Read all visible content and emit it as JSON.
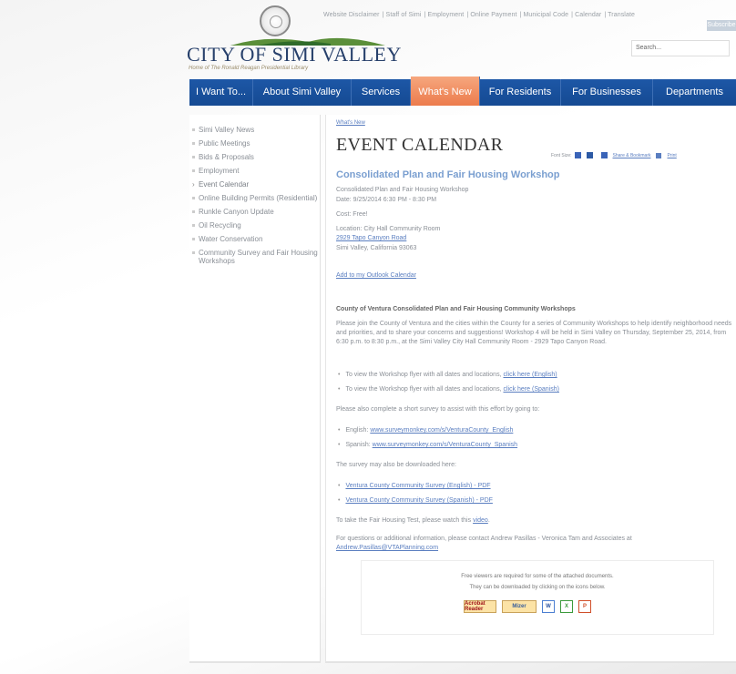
{
  "header": {
    "logo_text": "CITY OF SIMI VALLEY",
    "tagline": "Home of The Ronald Reagan Presidential Library",
    "utility_links": [
      "Website Disclaimer",
      "Staff of Simi",
      "Employment",
      "Online Payment",
      "Municipal Code",
      "Calendar",
      "Translate"
    ],
    "utility_button": "Subscribe",
    "search_placeholder": "Search..."
  },
  "nav": {
    "items": [
      {
        "label": "I Want To..."
      },
      {
        "label": "About Simi Valley"
      },
      {
        "label": "Services"
      },
      {
        "label": "What's New",
        "active": true
      },
      {
        "label": "For Residents"
      },
      {
        "label": "For Businesses"
      },
      {
        "label": "Departments"
      }
    ]
  },
  "sidebar": {
    "items": [
      "Simi Valley News",
      "Public Meetings",
      "Bids & Proposals",
      "Employment",
      "Event Calendar",
      "Online Building Permits (Residential)",
      "Runkle Canyon Update",
      "Oil Recycling",
      "Water Conservation",
      "Community Survey and Fair Housing Workshops"
    ]
  },
  "main": {
    "breadcrumb": "What's New",
    "page_title": "EVENT CALENDAR",
    "tools": {
      "font_size": "Font Size:",
      "share": "Share & Bookmark",
      "print": "Print"
    },
    "event": {
      "title": "Consolidated Plan and Fair Housing Workshop",
      "subtitle": "Consolidated Plan and Fair Housing Workshop",
      "date": "Date: 9/25/2014 6:30 PM - 8:30 PM",
      "cost": "Cost: Free!",
      "location_label": "Location: City Hall Community Room",
      "address_line1": "2929 Tapo Canyon Road",
      "address_line2": "Simi Valley, California 93063",
      "outlook_link": "Add to my Outlook Calendar"
    },
    "body": {
      "heading": "County of Ventura Consolidated Plan and Fair Housing Community Workshops",
      "intro": "Please join the County of Ventura and the cities within the County for a series of Community Workshops to help identify neighborhood needs and priorities, and to share your concerns and suggestions!  Workshop 4 will be held in Simi Valley on Thursday, September 25, 2014, from 6:30 p.m. to 8:30 p.m., at the Simi Valley City Hall Community Room - 2929 Tapo Canyon Road.",
      "flyer_text": "To view the Workshop flyer with all dates and locations,",
      "flyer_link_en": "click here (English)",
      "flyer_link_es": "click here (Spanish)",
      "survey_intro": "Please also complete a short survey to assist with this effort by going to:",
      "english_label": "English:",
      "english_link": "www.surveymonkey.com/s/VenturaCounty_English",
      "spanish_label": "Spanish:",
      "spanish_link": "www.surveymonkey.com/s/VenturaCounty_Spanish",
      "download_intro": "The survey may also be downloaded here:",
      "pdf_en": "Ventura County Community Survey (English) - PDF",
      "pdf_es": "Ventura County Community Survey (Spanish) - PDF",
      "fair_housing_text": "To take the Fair Housing Test, please watch this",
      "video_link": "video",
      "contact_text": "For questions or additional information, please contact Andrew Pasillas - Veronica Tam and Associates at",
      "contact_email": "Andrew.Pasillas@VTAPlanning.com"
    },
    "viewers": {
      "line1": "Free viewers are required for some of the attached documents.",
      "line2": "They can be downloaded by clicking on the icons below.",
      "acrobat": "Acrobat Reader",
      "mizer": "Mizer"
    }
  },
  "colors": {
    "nav_blue": "#1d57a6",
    "nav_active": "#ec7b4c",
    "logo_navy": "#27406b",
    "link_blue": "#5a7ec0"
  }
}
